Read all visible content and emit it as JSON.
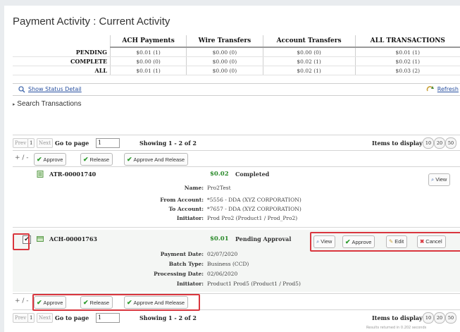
{
  "page_title": "Payment Activity : Current Activity",
  "summary": {
    "columns": [
      "ACH Payments",
      "Wire Transfers",
      "Account Transfers",
      "ALL TRANSACTIONS"
    ],
    "rows": [
      {
        "label": "PENDING",
        "cells": [
          "$0.01 (1)",
          "$0.00 (0)",
          "$0.00 (0)",
          "$0.01 (1)"
        ]
      },
      {
        "label": "COMPLETE",
        "cells": [
          "$0.00 (0)",
          "$0.00 (0)",
          "$0.02 (1)",
          "$0.02 (1)"
        ]
      },
      {
        "label": "ALL",
        "cells": [
          "$0.01 (1)",
          "$0.00 (0)",
          "$0.02 (1)",
          "$0.03 (2)"
        ]
      }
    ],
    "show_status_detail": "Show Status Detail",
    "refresh": "Refresh"
  },
  "search_transactions": "Search Transactions",
  "pager": {
    "prev": "Prev",
    "page": "1",
    "next": "Next",
    "go_to_page": "Go to page",
    "page_value": "1",
    "showing": "Showing 1 - 2 of 2",
    "items_to_display": "Items to display:",
    "counts": [
      "10",
      "20",
      "50"
    ]
  },
  "actions": {
    "plus_minus": "+ / -",
    "approve": "Approve",
    "release": "Release",
    "approve_release": "Approve And Release"
  },
  "transactions": [
    {
      "id": "ATR-00001740",
      "amount": "$0.02",
      "status": "Completed",
      "view": "View",
      "details": [
        {
          "label": "Name:",
          "value": "Pro2Test"
        },
        {
          "label": "From Account:",
          "value": "*5556 - DDA (XYZ CORPORATION)"
        },
        {
          "label": "To Account:",
          "value": "*7657 - DDA (XYZ CORPORATION)"
        },
        {
          "label": "Initiator:",
          "value": "Prod Pro2 (Product1 / Prod_Pro2)"
        }
      ]
    },
    {
      "id": "ACH-00001763",
      "amount": "$0.01",
      "status": "Pending Approval",
      "checked": "✔",
      "buttons": {
        "view": "View",
        "approve": "Approve",
        "edit": "Edit",
        "cancel": "Cancel"
      },
      "details": [
        {
          "label": "Payment Date:",
          "value": "02/07/2020"
        },
        {
          "label": "Batch Type:",
          "value": "Business (CCD)"
        },
        {
          "label": "Processing Date:",
          "value": "02/06/2020"
        },
        {
          "label": "Initiator:",
          "value": "Product1 Prod5 (Product1 / Prod5)"
        }
      ]
    }
  ],
  "footnote": "Results returned in 0.202 seconds",
  "colors": {
    "accent_red": "#d9363e",
    "check_green": "#2a9a2a",
    "link_blue": "#2850a0"
  }
}
